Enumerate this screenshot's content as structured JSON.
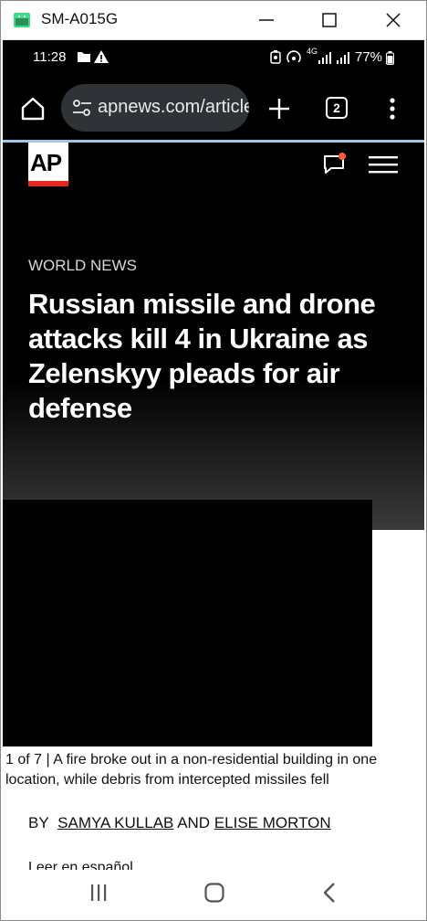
{
  "window": {
    "title": "SM-A015G"
  },
  "status_bar": {
    "time": "11:28",
    "network": "4G",
    "battery": "77%"
  },
  "browser": {
    "url": "apnews.com/article",
    "tab_count": "2"
  },
  "article": {
    "logo": "AP",
    "category": "WORLD NEWS",
    "headline": "Russian missile and drone attacks kill 4 in Ukraine as Zelenskyy pleads for air defense",
    "caption_counter": "1 of 7 |",
    "caption_text": "A fire broke out in a non-residential building in one location, while debris from intercepted missiles fell",
    "byline_prefix": "BY",
    "author1": "SAMYA KULLAB",
    "byline_and": "AND",
    "author2": "ELISE MORTON",
    "spanish_link": "Leer en español"
  },
  "colors": {
    "ap_red": "#e8281d",
    "notification_dot": "#ff5a3c"
  }
}
